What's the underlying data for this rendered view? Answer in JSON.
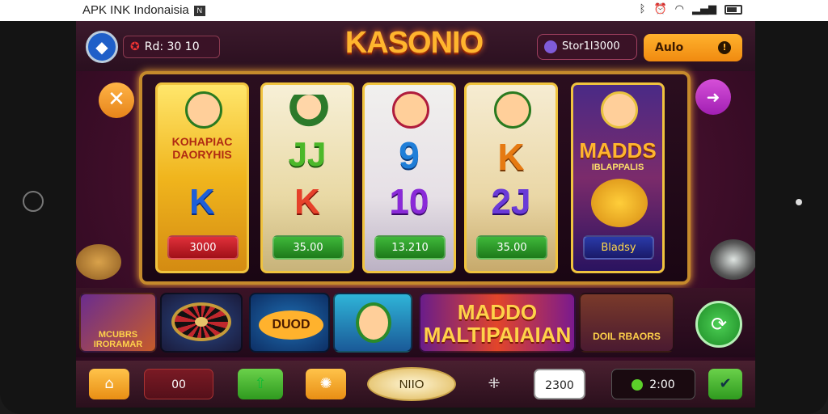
{
  "status_bar": {
    "left_text": "APK INK Indonaisia",
    "left_icon": "N",
    "icons": [
      "bluetooth-icon",
      "alarm-icon",
      "wifi-icon",
      "signal-icon",
      "battery-icon"
    ]
  },
  "header": {
    "home_icon": "◆",
    "balance_label": "Rd: 30 10",
    "logo": "KASONIO",
    "start_label": "Stor1l3000",
    "auto_label": "Aulo",
    "auto_icon": "!"
  },
  "side_buttons": {
    "close_icon": "✕",
    "share_icon": "➜"
  },
  "reels": [
    {
      "top": "KOHAPIAC DAORYHIS",
      "mid": "",
      "low": "K",
      "amount": "3000"
    },
    {
      "top": "",
      "mid": "JJ",
      "low": "K",
      "amount": "35.00"
    },
    {
      "top": "",
      "mid": "9",
      "low": "10",
      "amount": "13.210"
    },
    {
      "top": "",
      "mid": "K",
      "low": "2J",
      "amount": "35.00"
    },
    {
      "top": "MADDS",
      "mid": "IBLAPPALIS",
      "low": "",
      "amount": "Bladsy"
    }
  ],
  "games": [
    {
      "label": "MCUBRS IRORAMAR"
    },
    {
      "label": ""
    },
    {
      "label": "DUOD"
    },
    {
      "label": ""
    },
    {
      "label": "MADDO MALTIPAIAIAN"
    },
    {
      "label": "DOIL RBAORS"
    }
  ],
  "bottom": {
    "home_icon": "⌂",
    "bet_value": "00",
    "up_icon": "⇧",
    "gear_icon": "✺",
    "spin_label": "NIIO",
    "grid_icon": "⁜",
    "win_value": "2300",
    "credit_value": "2:00",
    "end_icon": "✔",
    "go_icon": "⟳"
  }
}
